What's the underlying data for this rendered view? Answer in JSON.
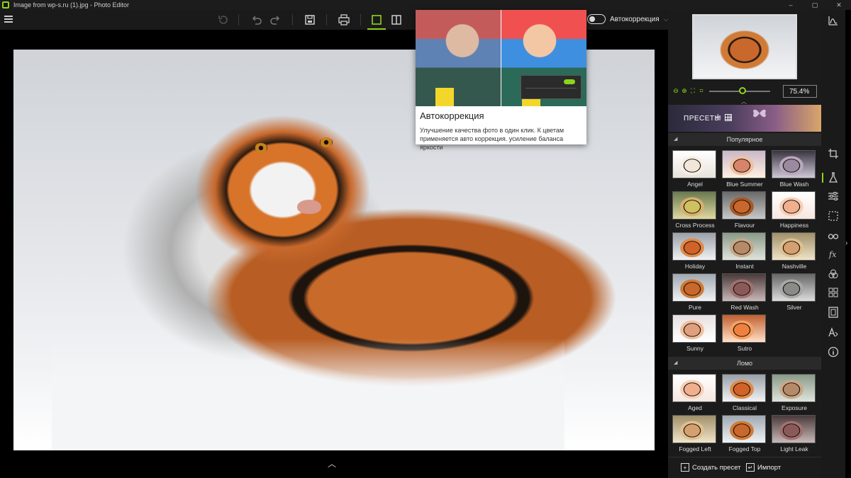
{
  "window": {
    "title": "Image from wp-s.ru (1).jpg - Photo Editor",
    "minimize": "–",
    "maximize": "▢",
    "close": "✕"
  },
  "toolbar": {
    "auto_correction_label": "Автокоррекция",
    "auto_correction_on": false
  },
  "popup": {
    "title": "Автокоррекция",
    "description": "Улучшение качества фото в один клик. К цветам применяется авто коррекция. усиление баланса яркости"
  },
  "zoom": {
    "value": "75.4%",
    "level_fraction": 0.55
  },
  "presets": {
    "header_label": "ПРЕСЕТЫ",
    "add_symbol": "+",
    "sections": [
      {
        "title": "Популярное",
        "items": [
          "Angel",
          "Blue Summer",
          "Blue Wash",
          "Cross Process",
          "Flavour",
          "Happiness",
          "Holiday",
          "Instant",
          "Nashville",
          "Pure",
          "Red Wash",
          "Silver",
          "Sunny",
          "Sutro"
        ]
      },
      {
        "title": "Ломо",
        "items": [
          "Aged",
          "Classical",
          "Exposure",
          "Fogged Left",
          "Fogged Top",
          "Light Leak"
        ]
      }
    ],
    "create_preset": "Создать пресет",
    "import": "Импорт"
  },
  "colors": {
    "accent": "#8fd41a",
    "panel_bg": "#1b1b1b",
    "toolbar_bg": "#1a1a1a"
  },
  "right_tools": [
    "histogram-icon",
    "crop-icon",
    "flask-icon",
    "sliders-icon",
    "selection-icon",
    "glasses-icon",
    "fx-icon",
    "color-circles-icon",
    "texture-icon",
    "frame-icon",
    "text-icon",
    "info-icon"
  ]
}
